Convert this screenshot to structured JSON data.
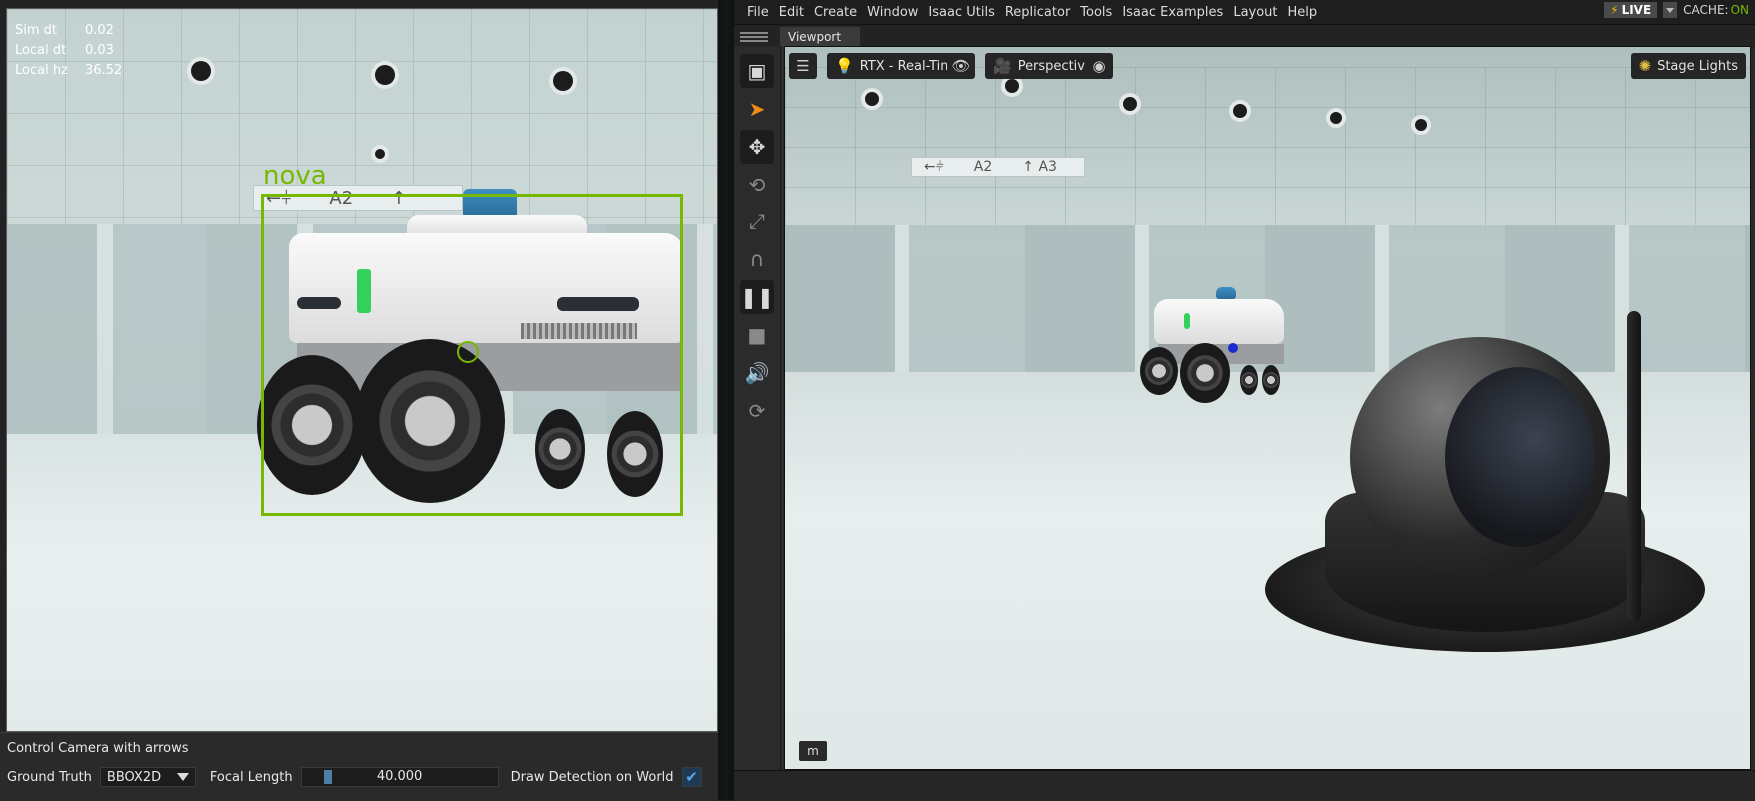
{
  "left": {
    "stats": [
      {
        "label": "Sim dt",
        "value": "0.02"
      },
      {
        "label": "Local dt",
        "value": "0.03"
      },
      {
        "label": "Local hz",
        "value": "36.52"
      }
    ],
    "bbox_label": "nova",
    "sign_text": {
      "arrows": "←⫩",
      "gate": "A2",
      "up": "↑"
    },
    "controls": {
      "title": "Control Camera with arrows",
      "ground_truth_label": "Ground Truth",
      "ground_truth_value": "BBOX2D",
      "focal_length_label": "Focal Length",
      "focal_length_value": "40.000",
      "draw_detection_label": "Draw Detection on World",
      "draw_detection_checked": "✔"
    }
  },
  "menubar": {
    "items": [
      "File",
      "Edit",
      "Create",
      "Window",
      "Isaac Utils",
      "Replicator",
      "Tools",
      "Isaac Examples",
      "Layout",
      "Help"
    ],
    "live_label": "LIVE",
    "cache_label": "CACHE:",
    "cache_value": "ON"
  },
  "viewport": {
    "tab_label": "Viewport",
    "render_mode": "RTX - Real-Time",
    "camera": "Perspective",
    "stage_lights": "Stage Lights",
    "sign_text": {
      "arrows": "←⫩",
      "gate": "A2",
      "gate2": "↑ A3"
    },
    "m_button": "m"
  },
  "colors": {
    "accent": "#76b900",
    "select_tool": "#f08c16",
    "bbox": "#76b900"
  }
}
